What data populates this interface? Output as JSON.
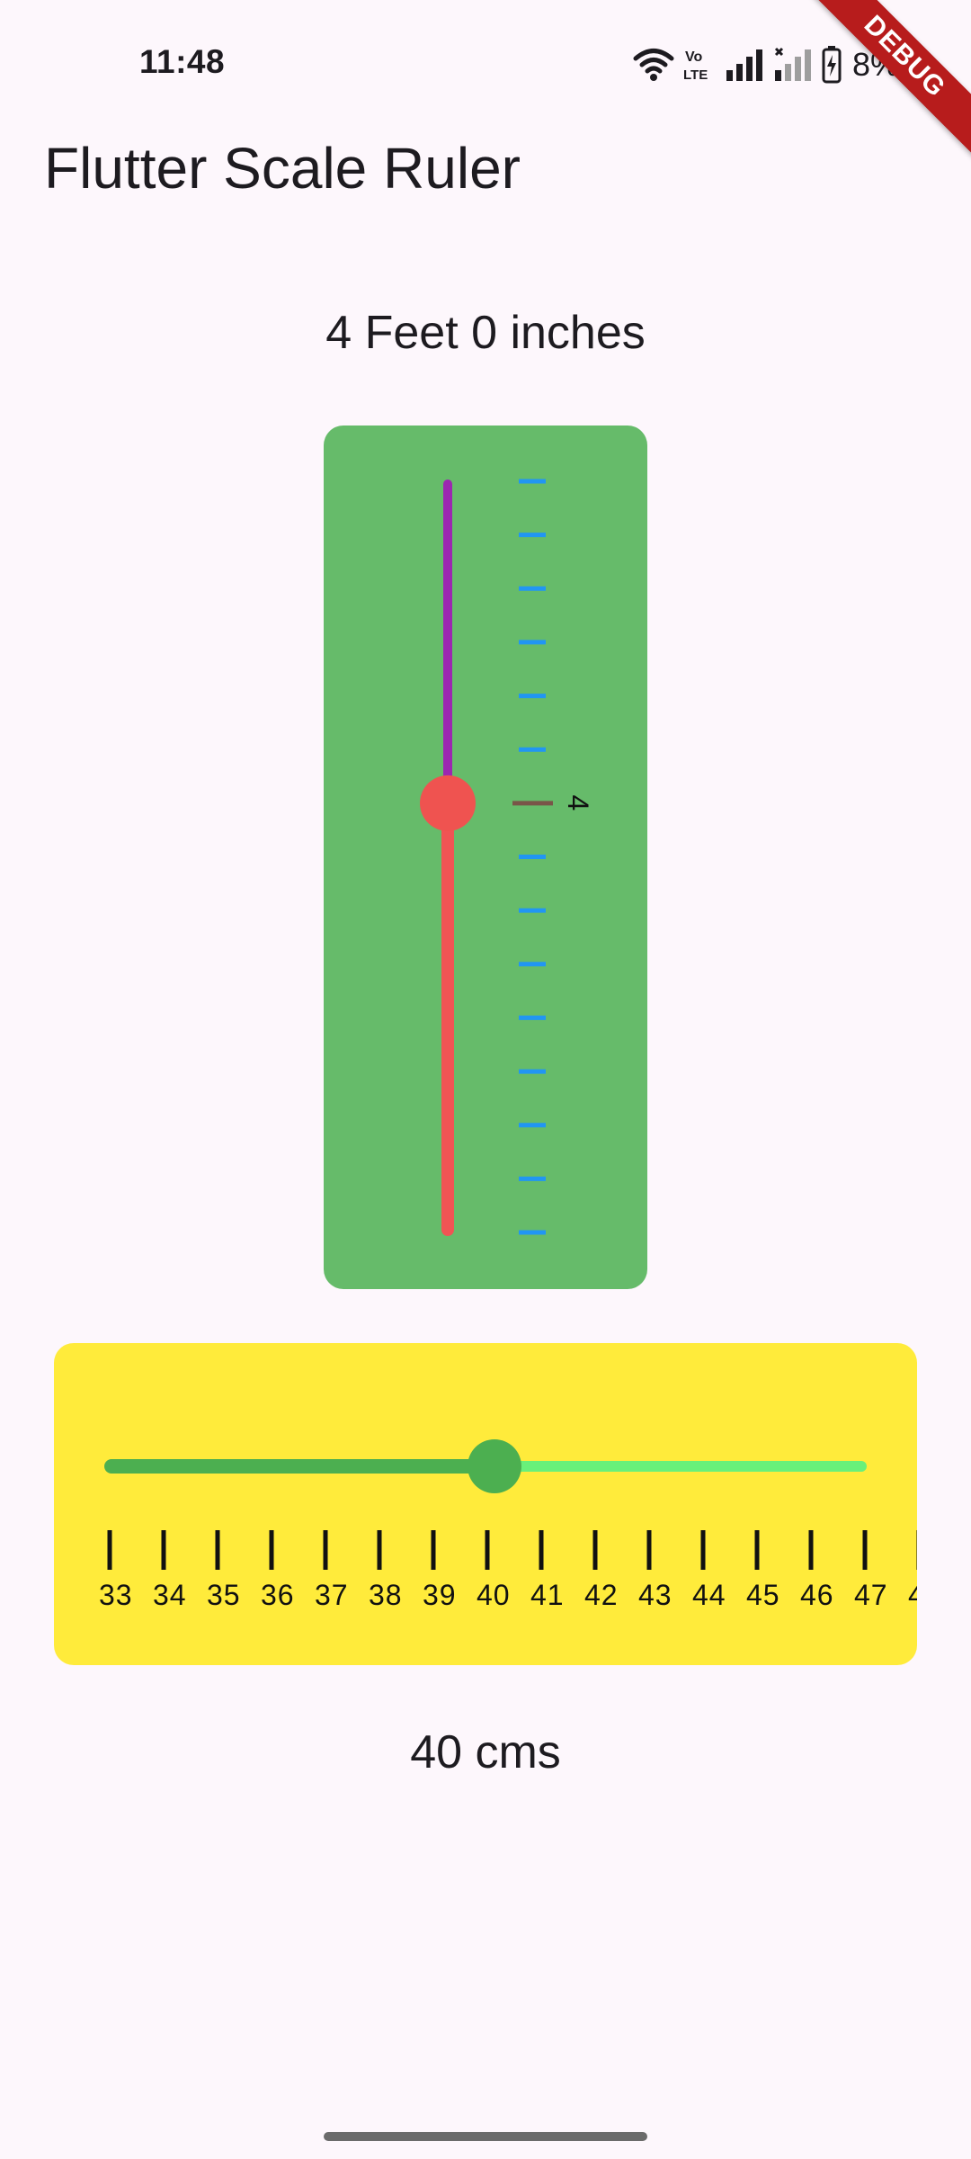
{
  "status_bar": {
    "time": "11:48",
    "battery_percent": "8%",
    "icons": [
      "wifi-icon",
      "volte-icon",
      "signal-icon",
      "signal-no-service-icon",
      "battery-charging-icon"
    ]
  },
  "debug_banner": {
    "label": "DEBUG",
    "color": "#b71c1c"
  },
  "app_bar": {
    "title": "Flutter Scale Ruler"
  },
  "height_ruler": {
    "readout": "4 Feet 0 inches",
    "value_feet": 4,
    "min_feet": 0,
    "max_feet": 7,
    "tick_count": 15,
    "labeled_tick": "4",
    "colors": {
      "card": "#66bb6a",
      "active_track": "#f05454",
      "inactive_track": "#9c27b0",
      "thumb": "#ef5350",
      "ticks": "#2196f3",
      "current_tick": "#795548"
    }
  },
  "length_ruler": {
    "readout": "40 cms",
    "value_cm": 40,
    "slider_fraction": 0.5,
    "tick_labels": [
      "33",
      "34",
      "35",
      "36",
      "37",
      "38",
      "39",
      "40",
      "41",
      "42",
      "43",
      "44",
      "45",
      "46",
      "47",
      "4"
    ],
    "colors": {
      "card": "#ffeb3b",
      "active_track": "#4caf50",
      "inactive_track": "#69f07a",
      "thumb": "#4caf50",
      "ticks": "#111111"
    }
  }
}
